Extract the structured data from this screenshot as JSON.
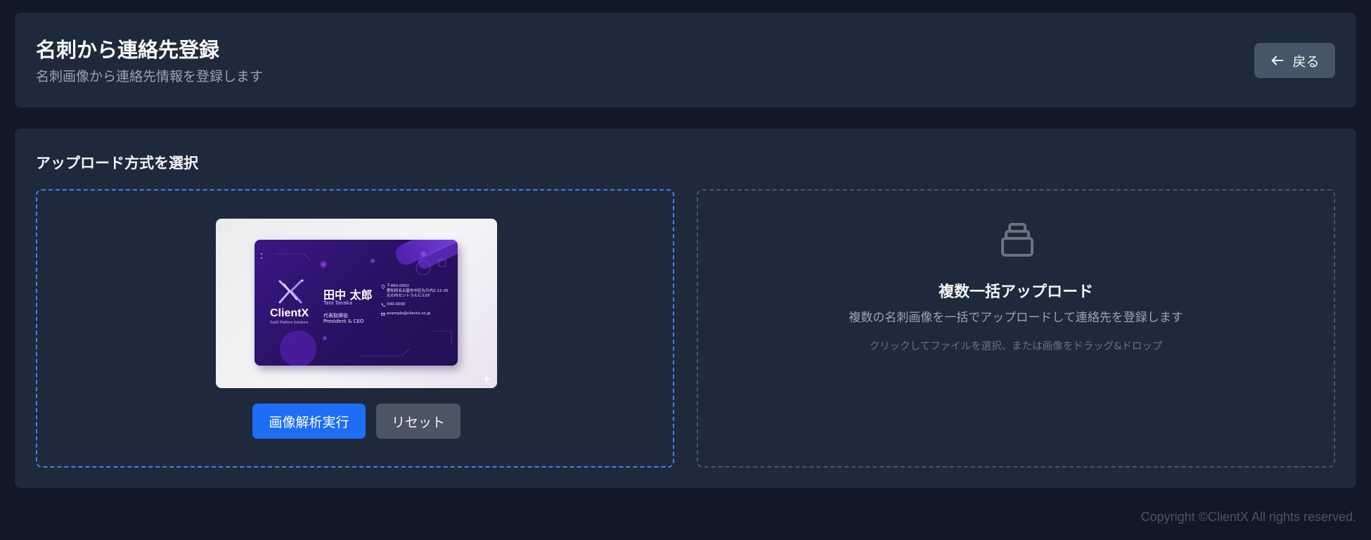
{
  "header": {
    "title": "名刺から連絡先登録",
    "subtitle": "名刺画像から連絡先情報を登録します",
    "back_label": "戻る",
    "back_icon": "arrow-left-icon"
  },
  "upload": {
    "section_title": "アップロード方式を選択",
    "single": {
      "analyze_label": "画像解析実行",
      "reset_label": "リセット"
    },
    "bulk": {
      "icon": "stack-icon",
      "title": "複数一括アップロード",
      "description": "複数の名刺画像を一括でアップロードして連絡先を登録します",
      "hint": "クリックしてファイルを選択、または画像をドラッグ&ドロップ"
    }
  },
  "business_card": {
    "brand": "ClientX",
    "tagline": "SaaS Platform Solutions",
    "name": "田中 太郎",
    "name_en": "Taro Tanaka",
    "role": "代表取締役",
    "role_en": "President & CEO",
    "postal": "〒460-0002",
    "address_line1": "愛知県名古屋市中区丸の内2-12-26",
    "address_line2": "丸の内セントラルビル5F",
    "phone": "000-0000",
    "email": "example@clientx.co.jp"
  },
  "footer": {
    "copyright": "Copyright ©ClientX All rights reserved."
  },
  "colors": {
    "background": "#111827",
    "panel": "#1e293b",
    "accent": "#1d6ef5",
    "active_border": "#3b82f6"
  }
}
